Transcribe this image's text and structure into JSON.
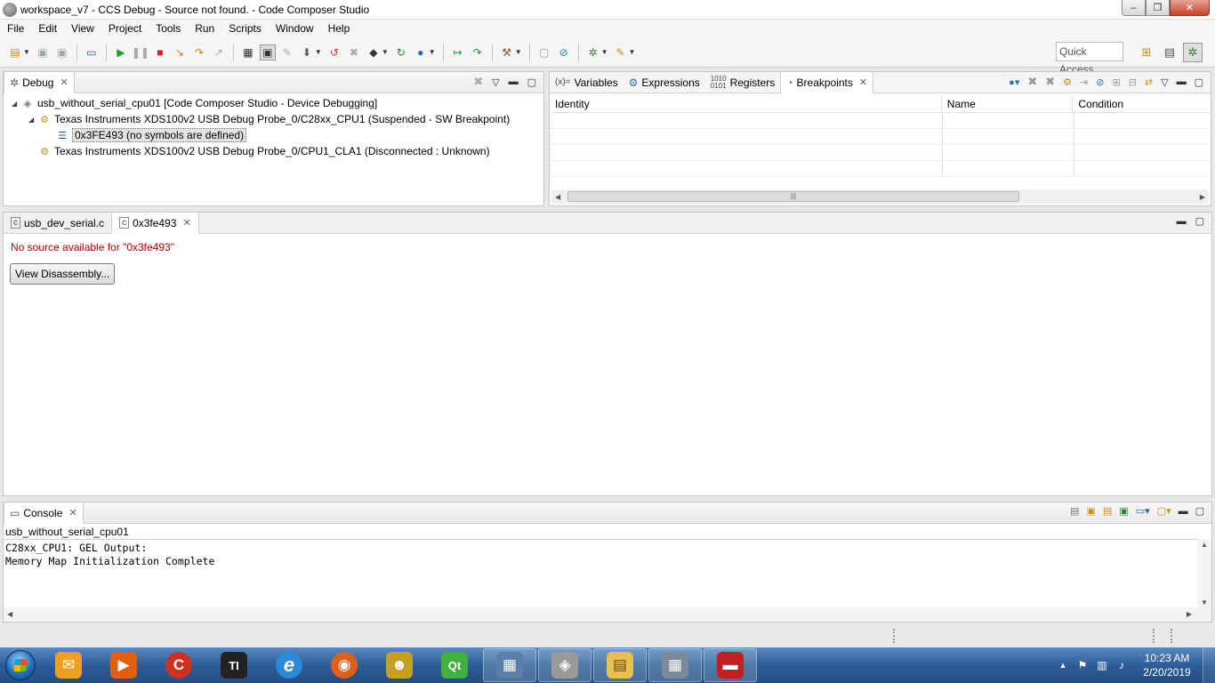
{
  "window": {
    "title": "workspace_v7 - CCS Debug - Source not found. - Code Composer Studio",
    "minimize": "–",
    "maximize": "❐",
    "close": "✕"
  },
  "menu": [
    "File",
    "Edit",
    "View",
    "Project",
    "Tools",
    "Run",
    "Scripts",
    "Window",
    "Help"
  ],
  "toolbar": {
    "quick_access": "Quick Access"
  },
  "debug_view": {
    "tab_label": "Debug",
    "tree": [
      {
        "label": "usb_without_serial_cpu01 [Code Composer Studio - Device Debugging]",
        "arrow": "◢"
      },
      {
        "label": "Texas Instruments XDS100v2 USB Debug Probe_0/C28xx_CPU1 (Suspended - SW Breakpoint)",
        "arrow": "◢"
      },
      {
        "label": "0x3FE493  (no symbols are defined)",
        "arrow": ""
      },
      {
        "label": "Texas Instruments XDS100v2 USB Debug Probe_0/CPU1_CLA1 (Disconnected : Unknown)",
        "arrow": ""
      }
    ]
  },
  "right_view": {
    "tabs": [
      {
        "label": "Variables",
        "prefix": "(x)="
      },
      {
        "label": "Expressions",
        "prefix": ""
      },
      {
        "label": "Registers",
        "prefix": ""
      },
      {
        "label": "Breakpoints",
        "prefix": ""
      }
    ],
    "columns": [
      "Identity",
      "Name",
      "Condition"
    ]
  },
  "editor": {
    "tabs": [
      {
        "label": "usb_dev_serial.c"
      },
      {
        "label": "0x3fe493"
      }
    ],
    "message": "No source available for \"0x3fe493\"",
    "button": "View Disassembly..."
  },
  "console": {
    "tab_label": "Console",
    "session": "usb_without_serial_cpu01",
    "lines": [
      "C28xx_CPU1: GEL Output:",
      "Memory Map Initialization Complete"
    ]
  },
  "taskbar": {
    "time": "10:23 AM",
    "date": "2/20/2019",
    "apps": [
      {
        "name": "outlook",
        "glyph": "✉",
        "color": "#f0a020"
      },
      {
        "name": "media",
        "glyph": "▶",
        "color": "#e06010"
      },
      {
        "name": "ccleaner",
        "glyph": "C",
        "color": "#d03020"
      },
      {
        "name": "ti",
        "glyph": "TI",
        "color": "#222222"
      },
      {
        "name": "ie",
        "glyph": "e",
        "color": "#2a8ad8"
      },
      {
        "name": "firefox",
        "glyph": "◉",
        "color": "#e0601a"
      },
      {
        "name": "toolbox",
        "glyph": "☻",
        "color": "#c8a020"
      },
      {
        "name": "qt",
        "glyph": "Qt",
        "color": "#41b040"
      },
      {
        "name": "control-panel",
        "glyph": "▦",
        "color": "#5a7fa8"
      },
      {
        "name": "ccs",
        "glyph": "◈",
        "color": "#9a9a9a"
      },
      {
        "name": "explorer",
        "glyph": "▤",
        "color": "#e8c050"
      },
      {
        "name": "calculator",
        "glyph": "▦",
        "color": "#7a8a9a"
      },
      {
        "name": "toolbox2",
        "glyph": "▬",
        "color": "#c02020"
      }
    ]
  },
  "colors": {
    "error_text": "#c00000",
    "taskbar": "#2d5d97"
  }
}
